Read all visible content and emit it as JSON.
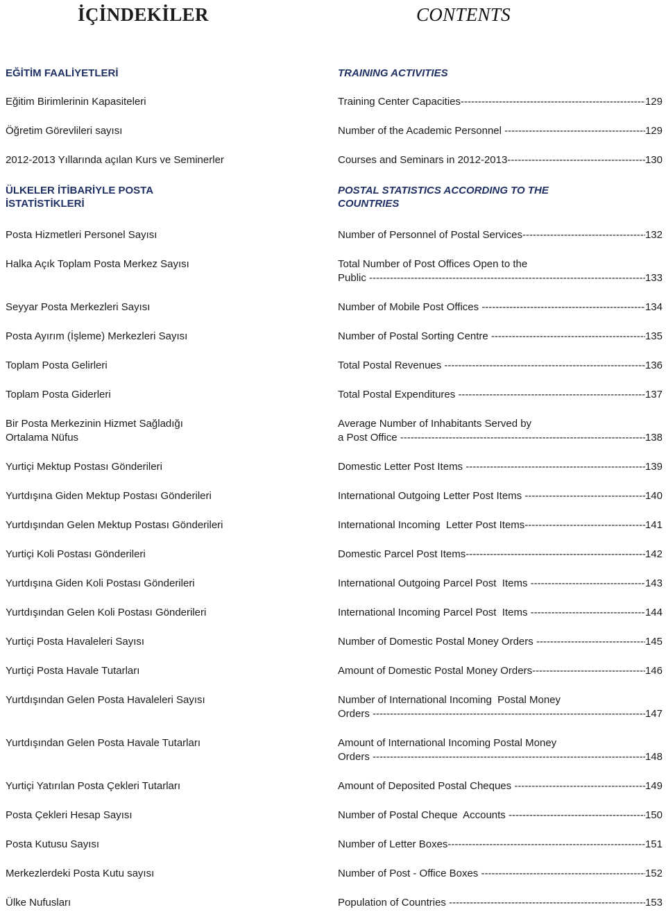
{
  "titles": {
    "turkish": "İÇİNDEKİLER",
    "english": "CONTENTS"
  },
  "colors": {
    "heading": "#1f3064",
    "body": "#1a1a1a"
  },
  "toc": {
    "rows": [
      {
        "type": "section",
        "tr": "EĞİTİM FAALİYETLERİ",
        "en": "TRAINING ACTIVITIES",
        "gap_before": 40
      },
      {
        "type": "entry",
        "tr": "Eğitim Birimlerinin Kapasiteleri",
        "en_lines": [
          "Training Center Capacities"
        ],
        "page": "129",
        "gap_before": 22
      },
      {
        "type": "entry",
        "tr": "Öğretim Görevlileri sayısı",
        "en_lines": [
          "Number of the Academic Personnel "
        ],
        "page": "129",
        "gap_before": 22
      },
      {
        "type": "entry",
        "tr": "2012-2013 Yıllarında açılan Kurs ve Seminerler",
        "en_lines": [
          "Courses and Seminars in 2012-2013"
        ],
        "page": "130",
        "gap_before": 22
      },
      {
        "type": "section",
        "tr": "ÜLKELER İTİBARİYLE POSTA\nİSTATİSTİKLERİ",
        "en": "POSTAL STATISTICS ACCORDING TO THE\nCOUNTRIES",
        "gap_before": 24
      },
      {
        "type": "entry",
        "tr": "Posta Hizmetleri Personel Sayısı",
        "en_lines": [
          "Number of Personnel of Postal Services"
        ],
        "page": "132",
        "gap_before": 26
      },
      {
        "type": "entry",
        "tr": "Halka Açık Toplam Posta Merkez Sayısı",
        "en_lines": [
          "Total Number of Post Offices Open to the",
          "Public "
        ],
        "page": "133",
        "gap_before": 22
      },
      {
        "type": "entry",
        "tr": "Seyyar Posta Merkezleri Sayısı",
        "en_lines": [
          "Number of Mobile Post Offices "
        ],
        "page": "134",
        "gap_before": 22
      },
      {
        "type": "entry",
        "tr": "Posta Ayırım (İşleme) Merkezleri Sayısı",
        "en_lines": [
          "Number of Postal Sorting Centre "
        ],
        "page": "135",
        "gap_before": 22
      },
      {
        "type": "entry",
        "tr": "Toplam Posta Gelirleri",
        "en_lines": [
          "Total Postal Revenues "
        ],
        "page": "136",
        "gap_before": 22
      },
      {
        "type": "entry",
        "tr": "Toplam Posta Giderleri",
        "en_lines": [
          "Total Postal Expenditures "
        ],
        "page": "137",
        "gap_before": 22
      },
      {
        "type": "entry",
        "tr": "Bir Posta Merkezinin Hizmet Sağladığı\nOrtalama Nüfus",
        "en_lines": [
          "Average Number of Inhabitants Served by",
          "a Post Office "
        ],
        "page": "138",
        "gap_before": 22
      },
      {
        "type": "entry",
        "tr": "Yurtiçi Mektup Postası Gönderileri",
        "en_lines": [
          "Domestic Letter Post Items "
        ],
        "page": "139",
        "gap_before": 22
      },
      {
        "type": "entry",
        "tr": "Yurtdışına Giden Mektup Postası Gönderileri",
        "en_lines": [
          "International Outgoing Letter Post Items "
        ],
        "page": "140",
        "gap_before": 22
      },
      {
        "type": "entry",
        "tr": "Yurtdışından Gelen Mektup Postası Gönderileri",
        "en_lines": [
          "International Incoming  Letter Post Items"
        ],
        "page": "141",
        "gap_before": 22
      },
      {
        "type": "entry",
        "tr": "Yurtiçi Koli Postası Gönderileri",
        "en_lines": [
          "Domestic Parcel Post Items"
        ],
        "page": "142",
        "gap_before": 22
      },
      {
        "type": "entry",
        "tr": "Yurtdışına Giden Koli Postası Gönderileri",
        "en_lines": [
          "International Outgoing Parcel Post  Items "
        ],
        "page": "143",
        "gap_before": 22
      },
      {
        "type": "entry",
        "tr": "Yurtdışından Gelen Koli Postası Gönderileri",
        "en_lines": [
          "International Incoming Parcel Post  Items "
        ],
        "page": "144",
        "gap_before": 22
      },
      {
        "type": "entry",
        "tr": "Yurtiçi Posta Havaleleri Sayısı",
        "en_lines": [
          "Number of Domestic Postal Money Orders "
        ],
        "page": "145",
        "gap_before": 22
      },
      {
        "type": "entry",
        "tr": "Yurtiçi Posta Havale Tutarları",
        "en_lines": [
          "Amount of Domestic Postal Money Orders"
        ],
        "page": "146",
        "gap_before": 22
      },
      {
        "type": "entry",
        "tr": "Yurtdışından Gelen Posta Havaleleri Sayısı",
        "en_lines": [
          "Number of International Incoming  Postal Money",
          "Orders "
        ],
        "page": "147",
        "gap_before": 22
      },
      {
        "type": "entry",
        "tr": "Yurtdışından Gelen Posta Havale Tutarları",
        "en_lines": [
          "Amount of International Incoming Postal Money",
          "Orders "
        ],
        "page": "148",
        "gap_before": 22
      },
      {
        "type": "entry",
        "tr": "Yurtiçi Yatırılan Posta Çekleri Tutarları",
        "en_lines": [
          "Amount of Deposited Postal Cheques "
        ],
        "page": "149",
        "gap_before": 22
      },
      {
        "type": "entry",
        "tr": "Posta Çekleri Hesap Sayısı",
        "en_lines": [
          "Number of Postal Cheque  Accounts "
        ],
        "page": "150",
        "gap_before": 22
      },
      {
        "type": "entry",
        "tr": "Posta Kutusu Sayısı",
        "en_lines": [
          "Number of Letter Boxes"
        ],
        "page": "151",
        "gap_before": 22
      },
      {
        "type": "entry",
        "tr": "Merkezlerdeki Posta Kutu sayısı",
        "en_lines": [
          "Number of Post - Office Boxes "
        ],
        "page": "152",
        "gap_before": 22
      },
      {
        "type": "entry",
        "tr": "Ülke Nufusları",
        "en_lines": [
          "Population of Countries "
        ],
        "page": "153",
        "gap_before": 22
      }
    ]
  }
}
